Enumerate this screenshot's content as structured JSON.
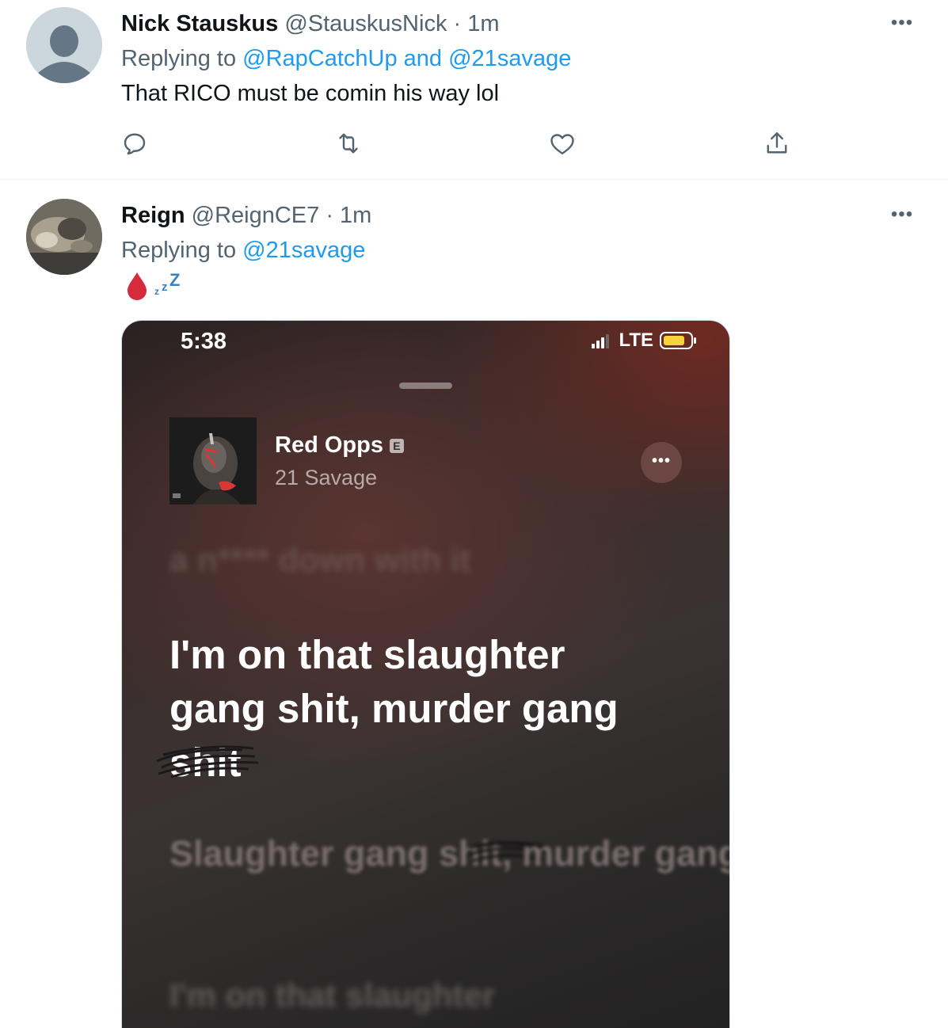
{
  "tweets": [
    {
      "name": "Nick Stauskus",
      "handle": "@StauskusNick",
      "separator": "·",
      "time": "1m",
      "replying_prefix": "Replying to",
      "replying_targets": "@RapCatchUp and @21savage",
      "text": "That RICO must be comin his way lol",
      "more_icon": "more-icon",
      "actions": [
        "reply-icon",
        "retweet-icon",
        "like-icon",
        "share-icon"
      ]
    },
    {
      "name": "Reign",
      "handle": "@ReignCE7",
      "separator": "·",
      "time": "1m",
      "replying_prefix": "Replying to",
      "replying_targets": "@21savage",
      "emoji": [
        "blood-drop-emoji",
        "sleeping-zzz-emoji"
      ],
      "more_icon": "more-icon"
    }
  ],
  "media": {
    "status_time": "5:38",
    "network": "LTE",
    "song_title": "Red Opps",
    "explicit_badge": "E",
    "artist": "21 Savage",
    "lyrics_prev": "a n**** down with it",
    "lyrics_current_1": "I'm on that slaughter",
    "lyrics_current_2": "gang shit, murder gang",
    "lyrics_current_3": "shit",
    "lyrics_next_1": "Slaughter gang shit,",
    "lyrics_next_2": "murder gang shit",
    "lyrics_after": "I'm on that slaughter"
  },
  "colors": {
    "link": "#1d9bf0",
    "muted": "#536471",
    "text": "#0f1419"
  }
}
